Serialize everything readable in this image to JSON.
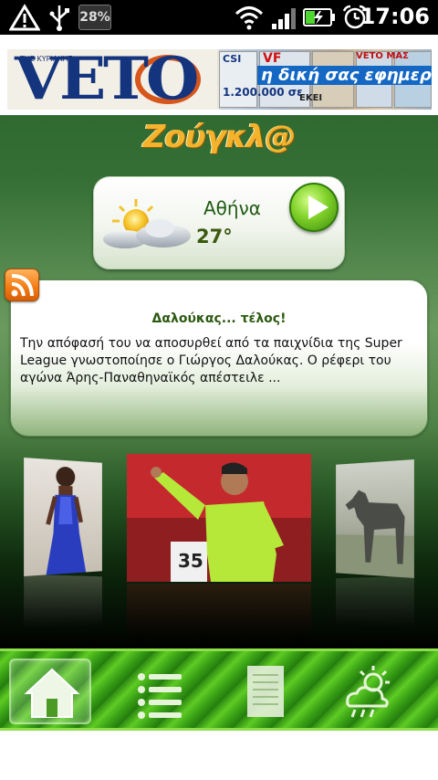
{
  "status_bar": {
    "battery_percent": "28%",
    "time": "17:06",
    "icons": [
      "warning-icon",
      "usb-icon",
      "battery-percent-badge",
      "wifi-icon",
      "signal-icon",
      "battery-charging-icon",
      "alarm-icon"
    ]
  },
  "ad_banner": {
    "brand_small": "ΤΗΣ ΚΥΡΙΑΚΗΣ",
    "brand": "VETO",
    "slogan": "η δική σας εφημερίδα",
    "snippets": [
      "CSI",
      "1.200.000 σε",
      "VF",
      "VETO ΜΑΣ",
      "ΕΚΕΙ"
    ]
  },
  "app_logo": "Ζούγκλ@",
  "weather": {
    "city": "Αθήνα",
    "temperature": "27°",
    "icon": "partly-cloudy-icon"
  },
  "news": {
    "title": "Δαλούκας... τέλος!",
    "summary": "Την απόφασή του να αποσυρθεί από τα παιχνίδια της Super League γνωστοποίησε ο Γιώργος Δαλούκας. Ο ρέφερι του αγώνα Άρης-Παναθηναϊκός απέστειλε ..."
  },
  "carousel": {
    "center_jersey_number": "35"
  },
  "tab_bar": {
    "tabs": [
      {
        "icon": "home-icon",
        "active": true
      },
      {
        "icon": "list-icon",
        "active": false
      },
      {
        "icon": "document-icon",
        "active": false
      },
      {
        "icon": "weather-icon",
        "active": false
      }
    ]
  },
  "colors": {
    "primary_green": "#2f6a31",
    "accent_orange": "#f4b32a",
    "title_green": "#2c5a10",
    "tab_green": "#3aa216"
  }
}
